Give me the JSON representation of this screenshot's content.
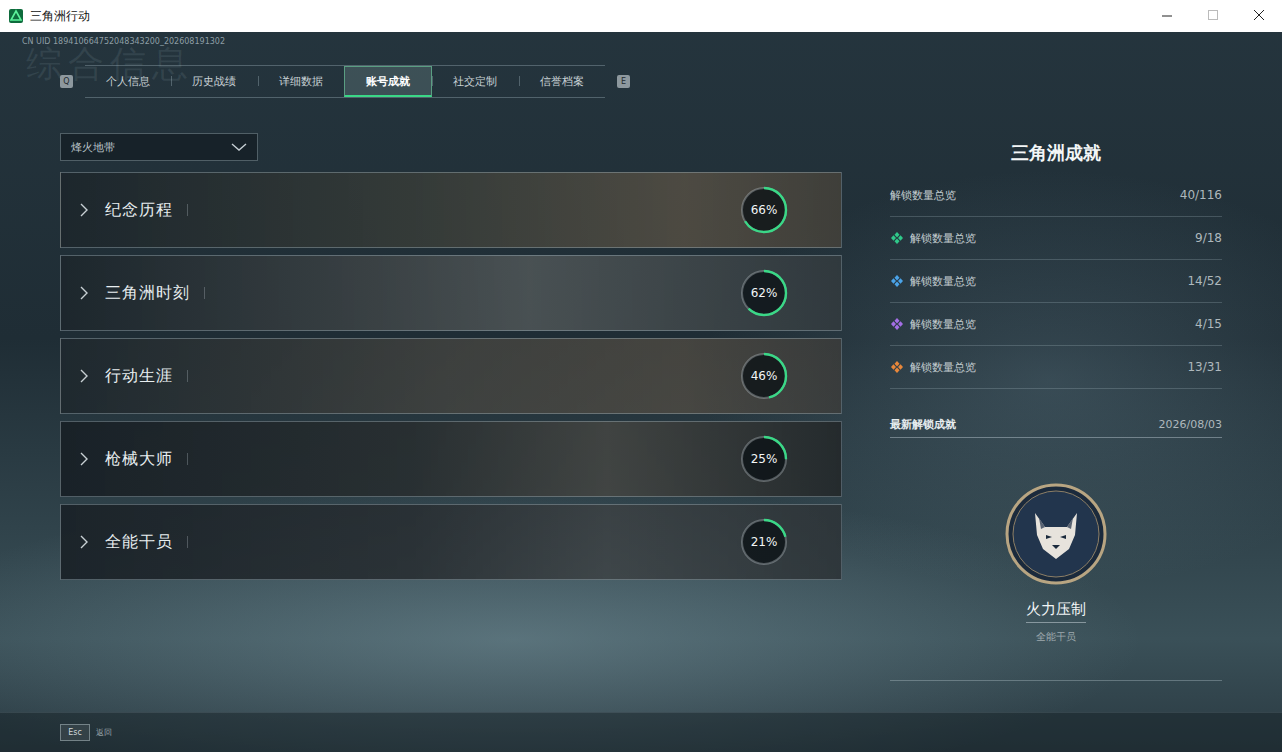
{
  "window": {
    "title": "三角洲行动"
  },
  "uid": "CN UID 189410664752048343200_202608191302",
  "watermark": "综合信息",
  "tabs": {
    "prev_key": "Q",
    "next_key": "E",
    "items": [
      {
        "label": "个人信息",
        "selected": false
      },
      {
        "label": "历史战绩",
        "selected": false
      },
      {
        "label": "详细数据",
        "selected": false
      },
      {
        "label": "账号成就",
        "selected": true
      },
      {
        "label": "社交定制",
        "selected": false
      },
      {
        "label": "信誉档案",
        "selected": false
      }
    ]
  },
  "mode_select": {
    "value": "烽火地带"
  },
  "categories": [
    {
      "name": "纪念历程",
      "percent": "66%",
      "level": 0.66
    },
    {
      "name": "三角洲时刻",
      "percent": "62%",
      "level": 0.62
    },
    {
      "name": "行动生涯",
      "percent": "46%",
      "level": 0.46
    },
    {
      "name": "枪械大师",
      "percent": "25%",
      "level": 0.25
    },
    {
      "name": "全能干员",
      "percent": "21%",
      "level": 0.21
    }
  ],
  "summary": {
    "title": "三角洲成就",
    "total": {
      "label": "解锁数量总览",
      "count": "40/116"
    },
    "tiers": [
      {
        "label": "解锁数量总览",
        "count": "9/18",
        "color": "#2fc98a"
      },
      {
        "label": "解锁数量总览",
        "count": "14/52",
        "color": "#4aa3e8"
      },
      {
        "label": "解锁数量总览",
        "count": "4/15",
        "color": "#a46ee6"
      },
      {
        "label": "解锁数量总览",
        "count": "13/31",
        "color": "#e8873a"
      }
    ]
  },
  "latest": {
    "label": "最新解锁成就",
    "date": "2026/08/03",
    "name": "火力压制",
    "category": "全能干员"
  },
  "footer": {
    "key": "Esc",
    "label": "返回"
  }
}
